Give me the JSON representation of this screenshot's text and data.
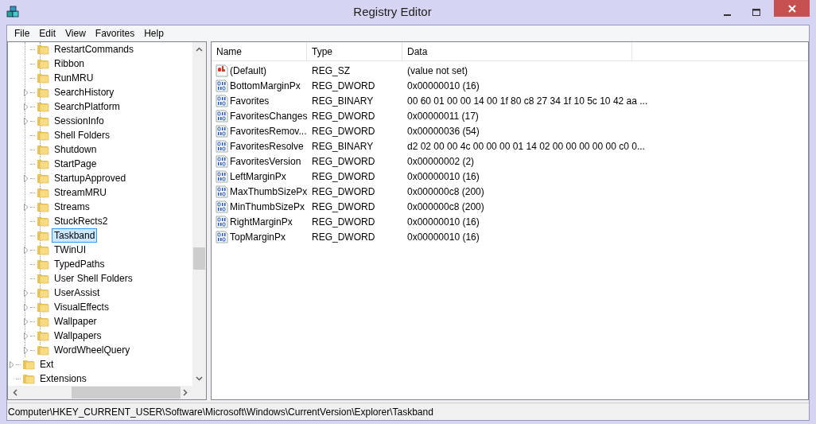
{
  "window": {
    "title": "Registry Editor"
  },
  "menu": [
    "File",
    "Edit",
    "View",
    "Favorites",
    "Help"
  ],
  "tree": {
    "items": [
      {
        "children": [
          {
            "label": "RestartCommands",
            "expandable": false,
            "selected": false
          },
          {
            "label": "Ribbon",
            "expandable": false,
            "selected": false
          },
          {
            "label": "RunMRU",
            "expandable": false,
            "selected": false
          },
          {
            "label": "SearchHistory",
            "expandable": true,
            "selected": false
          },
          {
            "label": "SearchPlatform",
            "expandable": true,
            "selected": false
          },
          {
            "label": "SessionInfo",
            "expandable": true,
            "selected": false
          },
          {
            "label": "Shell Folders",
            "expandable": false,
            "selected": false
          },
          {
            "label": "Shutdown",
            "expandable": false,
            "selected": false
          },
          {
            "label": "StartPage",
            "expandable": false,
            "selected": false
          },
          {
            "label": "StartupApproved",
            "expandable": true,
            "selected": false
          },
          {
            "label": "StreamMRU",
            "expandable": false,
            "selected": false
          },
          {
            "label": "Streams",
            "expandable": true,
            "selected": false
          },
          {
            "label": "StuckRects2",
            "expandable": false,
            "selected": false
          },
          {
            "label": "Taskband",
            "expandable": false,
            "selected": true
          },
          {
            "label": "TWinUI",
            "expandable": true,
            "selected": false
          },
          {
            "label": "TypedPaths",
            "expandable": false,
            "selected": false
          },
          {
            "label": "User Shell Folders",
            "expandable": false,
            "selected": false
          },
          {
            "label": "UserAssist",
            "expandable": true,
            "selected": false
          },
          {
            "label": "VisualEffects",
            "expandable": true,
            "selected": false
          },
          {
            "label": "Wallpaper",
            "expandable": true,
            "selected": false
          },
          {
            "label": "Wallpapers",
            "expandable": true,
            "selected": false
          },
          {
            "label": "WordWheelQuery",
            "expandable": true,
            "selected": false
          }
        ]
      },
      {
        "label": "Ext",
        "expandable": true,
        "selected": false
      },
      {
        "label": "Extensions",
        "expandable": false,
        "selected": false
      }
    ]
  },
  "table": {
    "columns": [
      "Name",
      "Type",
      "Data"
    ],
    "rows": [
      {
        "kind": "string",
        "name": "(Default)",
        "type": "REG_SZ",
        "data": "(value not set)"
      },
      {
        "kind": "binary",
        "name": "BottomMarginPx",
        "type": "REG_DWORD",
        "data": "0x00000010 (16)"
      },
      {
        "kind": "binary",
        "name": "Favorites",
        "type": "REG_BINARY",
        "data": "00 60 01 00 00 14 00 1f 80 c8 27 34 1f 10 5c 10 42 aa ..."
      },
      {
        "kind": "binary",
        "name": "FavoritesChanges",
        "type": "REG_DWORD",
        "data": "0x00000011 (17)"
      },
      {
        "kind": "binary",
        "name": "FavoritesRemov...",
        "type": "REG_DWORD",
        "data": "0x00000036 (54)"
      },
      {
        "kind": "binary",
        "name": "FavoritesResolve",
        "type": "REG_BINARY",
        "data": "d2 02 00 00 4c 00 00 00 01 14 02 00 00 00 00 00 c0 0..."
      },
      {
        "kind": "binary",
        "name": "FavoritesVersion",
        "type": "REG_DWORD",
        "data": "0x00000002 (2)"
      },
      {
        "kind": "binary",
        "name": "LeftMarginPx",
        "type": "REG_DWORD",
        "data": "0x00000010 (16)"
      },
      {
        "kind": "binary",
        "name": "MaxThumbSizePx",
        "type": "REG_DWORD",
        "data": "0x000000c8 (200)"
      },
      {
        "kind": "binary",
        "name": "MinThumbSizePx",
        "type": "REG_DWORD",
        "data": "0x000000c8 (200)"
      },
      {
        "kind": "binary",
        "name": "RightMarginPx",
        "type": "REG_DWORD",
        "data": "0x00000010 (16)"
      },
      {
        "kind": "binary",
        "name": "TopMarginPx",
        "type": "REG_DWORD",
        "data": "0x00000010 (16)"
      }
    ]
  },
  "status_bar": "Computer\\HKEY_CURRENT_USER\\Software\\Microsoft\\Windows\\CurrentVersion\\Explorer\\Taskband"
}
